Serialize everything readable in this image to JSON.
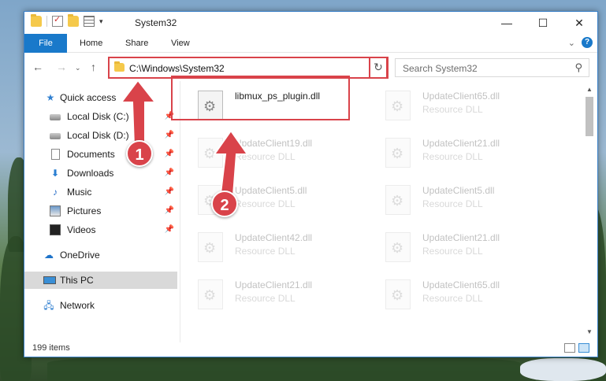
{
  "window": {
    "title": "System32"
  },
  "ribbon": {
    "tabs": [
      "File",
      "Home",
      "Share",
      "View"
    ]
  },
  "address": {
    "path": "C:\\Windows\\System32"
  },
  "search": {
    "placeholder": "Search System32"
  },
  "sidebar": {
    "items": [
      {
        "label": "Quick access",
        "icon": "star-icon",
        "pinned": false
      },
      {
        "label": "Local Disk (C:)",
        "icon": "drive-icon",
        "pinned": true
      },
      {
        "label": "Local Disk (D:)",
        "icon": "drive-icon",
        "pinned": true
      },
      {
        "label": "Documents",
        "icon": "documents-icon",
        "pinned": true
      },
      {
        "label": "Downloads",
        "icon": "downloads-icon",
        "pinned": true
      },
      {
        "label": "Music",
        "icon": "music-icon",
        "pinned": true
      },
      {
        "label": "Pictures",
        "icon": "pictures-icon",
        "pinned": true
      },
      {
        "label": "Videos",
        "icon": "videos-icon",
        "pinned": true
      },
      {
        "label": "OneDrive",
        "icon": "onedrive-icon",
        "pinned": false
      },
      {
        "label": "This PC",
        "icon": "this-pc-icon",
        "pinned": false,
        "selected": true
      },
      {
        "label": "Network",
        "icon": "network-icon",
        "pinned": false
      }
    ]
  },
  "files": [
    {
      "name": "libmux_ps_plugin.dll",
      "type": "",
      "highlighted": true
    },
    {
      "name": "UpdateClient65.dll",
      "type": "Resource DLL"
    },
    {
      "name": "UpdateClient19.dll",
      "type": "Resource DLL"
    },
    {
      "name": "UpdateClient21.dll",
      "type": "Resource DLL"
    },
    {
      "name": "UpdateClient5.dll",
      "type": "Resource DLL"
    },
    {
      "name": "UpdateClient5.dll",
      "type": "Resource DLL"
    },
    {
      "name": "UpdateClient42.dll",
      "type": "Resource DLL"
    },
    {
      "name": "UpdateClient21.dll",
      "type": "Resource DLL"
    },
    {
      "name": "UpdateClient21.dll",
      "type": "Resource DLL"
    },
    {
      "name": "UpdateClient65.dll",
      "type": "Resource DLL"
    }
  ],
  "status": {
    "item_count": "199 items"
  },
  "callouts": [
    "1",
    "2"
  ],
  "colors": {
    "accent": "#1979ca",
    "annotation_red": "#d9434a"
  }
}
